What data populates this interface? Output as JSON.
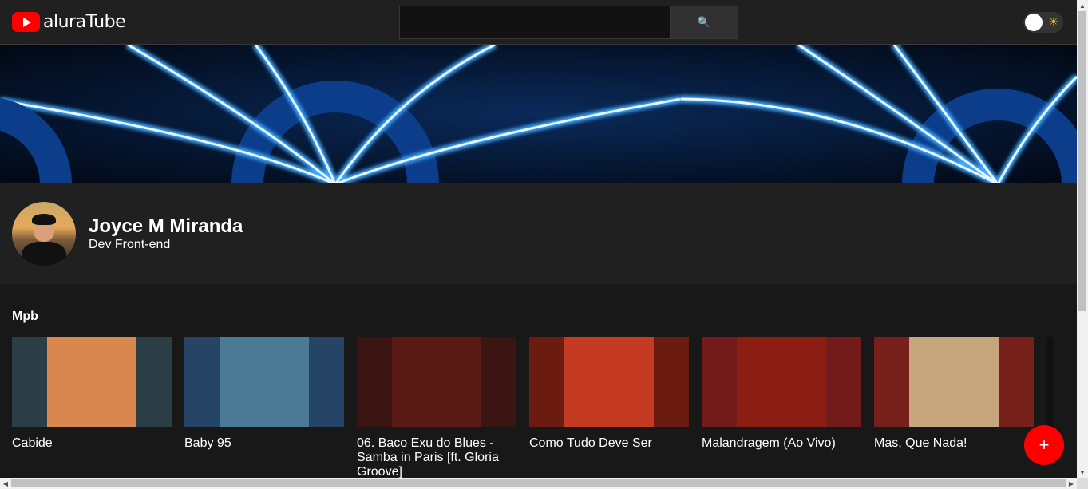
{
  "header": {
    "logo_text": "aluraTube",
    "search_placeholder": "",
    "search_icon": "🔍"
  },
  "theme_toggle": {
    "icon": "☀"
  },
  "profile": {
    "name": "Joyce M Miranda",
    "role": "Dev Front-end"
  },
  "playlist": {
    "title": "Mpb",
    "videos": [
      {
        "title": "Cabide",
        "bg": "#2c3e45",
        "art": "#d9874e"
      },
      {
        "title": "Baby 95",
        "bg": "#264466",
        "art": "#4b7996"
      },
      {
        "title": "06. Baco Exu do Blues - Samba in Paris [ft. Gloria Groove]",
        "bg": "#3a1512",
        "art": "#5a1a14"
      },
      {
        "title": "Como Tudo Deve Ser",
        "bg": "#6b1b0f",
        "art": "#c43a23"
      },
      {
        "title": "Malandragem (Ao Vivo)",
        "bg": "#731a1a",
        "art": "#8b1d12"
      },
      {
        "title": "Mas, Que Nada!",
        "bg": "#761f1b",
        "art": "#c7a57d"
      }
    ]
  },
  "fab": {
    "label": "+"
  },
  "colors": {
    "accent": "#ff0000",
    "background": "#181818",
    "surface": "#202020"
  }
}
